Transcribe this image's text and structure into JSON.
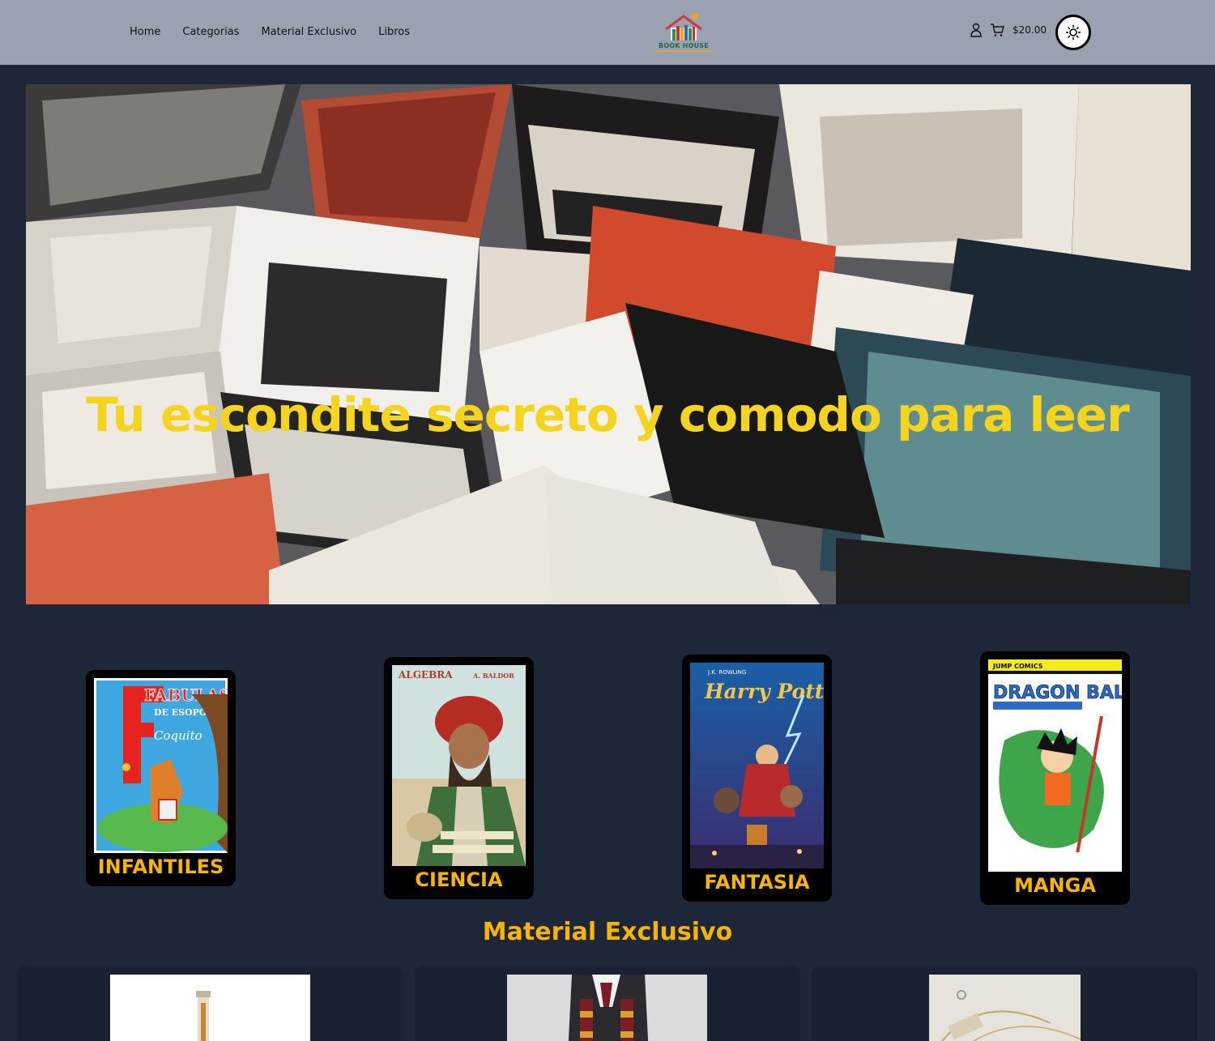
{
  "header": {
    "nav": [
      "Home",
      "Categorias",
      "Material Exclusivo",
      "Libros"
    ],
    "logo_text": "BOOK HOUSE",
    "cart_total": "$20.00"
  },
  "hero": {
    "title": "Tu escondite secreto y comodo para leer"
  },
  "categories": [
    {
      "label": "INFANTILES",
      "cover_title": "FABULAS",
      "cover_sub": "DE ESOPO",
      "cover_extra": "Coquito"
    },
    {
      "label": "CIENCIA",
      "cover_title": "ALGEBRA",
      "cover_sub": "A. BALDOR"
    },
    {
      "label": "FANTASIA",
      "cover_title": "Harry Potter",
      "cover_sub": "J.K. ROWLING"
    },
    {
      "label": "MANGA",
      "cover_title": "DRAGON BALL",
      "cover_sub": "JUMP COMICS"
    }
  ],
  "exclusive": {
    "title": "Material Exclusivo"
  },
  "colors": {
    "background": "#1e2738",
    "header": "#9aa2b1",
    "accent": "#f7b500",
    "hero_title": "#f5d41f"
  }
}
